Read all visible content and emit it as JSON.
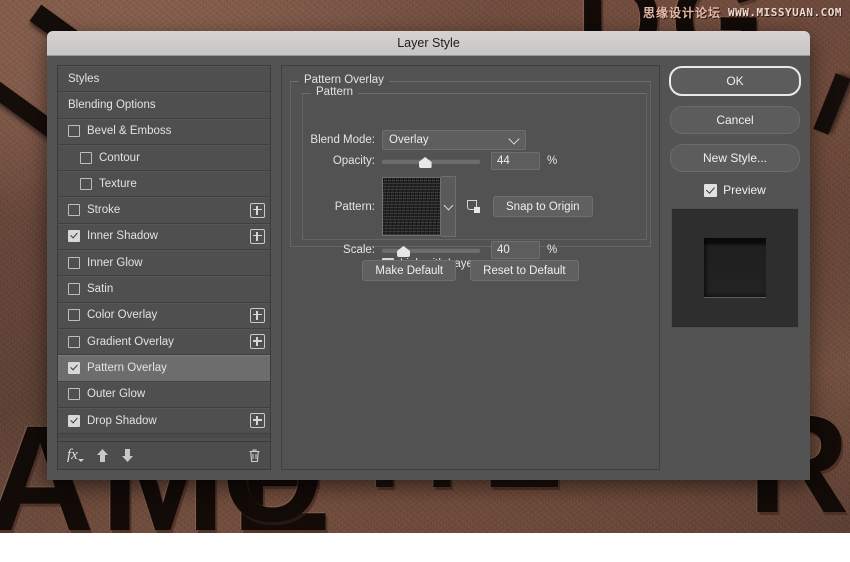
{
  "window": {
    "title": "Layer Style"
  },
  "watermark": {
    "cn": "思缘设计论坛",
    "url": "WWW.MISSYUAN.COM"
  },
  "effects_panel": {
    "items": [
      {
        "label": "Styles",
        "checkbox": "none",
        "indent": false,
        "plus": false
      },
      {
        "label": "Blending Options",
        "checkbox": "none",
        "indent": false,
        "plus": false
      },
      {
        "label": "Bevel & Emboss",
        "checkbox": "unchecked",
        "indent": false,
        "plus": false
      },
      {
        "label": "Contour",
        "checkbox": "unchecked",
        "indent": true,
        "plus": false
      },
      {
        "label": "Texture",
        "checkbox": "unchecked",
        "indent": true,
        "plus": false
      },
      {
        "label": "Stroke",
        "checkbox": "unchecked",
        "indent": false,
        "plus": true
      },
      {
        "label": "Inner Shadow",
        "checkbox": "checked",
        "indent": false,
        "plus": true
      },
      {
        "label": "Inner Glow",
        "checkbox": "unchecked",
        "indent": false,
        "plus": false
      },
      {
        "label": "Satin",
        "checkbox": "unchecked",
        "indent": false,
        "plus": false
      },
      {
        "label": "Color Overlay",
        "checkbox": "unchecked",
        "indent": false,
        "plus": true
      },
      {
        "label": "Gradient Overlay",
        "checkbox": "unchecked",
        "indent": false,
        "plus": true
      },
      {
        "label": "Pattern Overlay",
        "checkbox": "checked",
        "indent": false,
        "plus": false,
        "selected": true
      },
      {
        "label": "Outer Glow",
        "checkbox": "unchecked",
        "indent": false,
        "plus": false
      },
      {
        "label": "Drop Shadow",
        "checkbox": "checked",
        "indent": false,
        "plus": true
      }
    ],
    "toolbar": {
      "fx_label": "fx",
      "move_up_icon": "arrow-up-icon",
      "move_down_icon": "arrow-down-icon",
      "delete_icon": "trash-icon"
    }
  },
  "options_panel": {
    "section_title": "Pattern Overlay",
    "group_title": "Pattern",
    "blend_mode": {
      "label": "Blend Mode:",
      "value": "Overlay"
    },
    "opacity": {
      "label": "Opacity:",
      "value": "44",
      "unit": "%",
      "percent": 44
    },
    "pattern": {
      "label": "Pattern:",
      "snap_button": "Snap to Origin",
      "new_pattern_icon": "new-pattern-icon"
    },
    "scale": {
      "label": "Scale:",
      "value": "40",
      "unit": "%",
      "percent": 22
    },
    "link_with_layer": {
      "label": "Link with Layer",
      "checked": true
    },
    "make_default": "Make Default",
    "reset_to_default": "Reset to Default"
  },
  "actions_panel": {
    "ok": "OK",
    "cancel": "Cancel",
    "new_style": "New Style...",
    "preview": {
      "label": "Preview",
      "checked": true
    }
  },
  "colors": {
    "dialog_bg": "#535353",
    "panel_bg": "#4f4f4f",
    "selected_row": "#6d6d6d",
    "titlebar": "#d0cecc",
    "text": "#e4e4e4",
    "background_photo": "#6b4a3e"
  }
}
